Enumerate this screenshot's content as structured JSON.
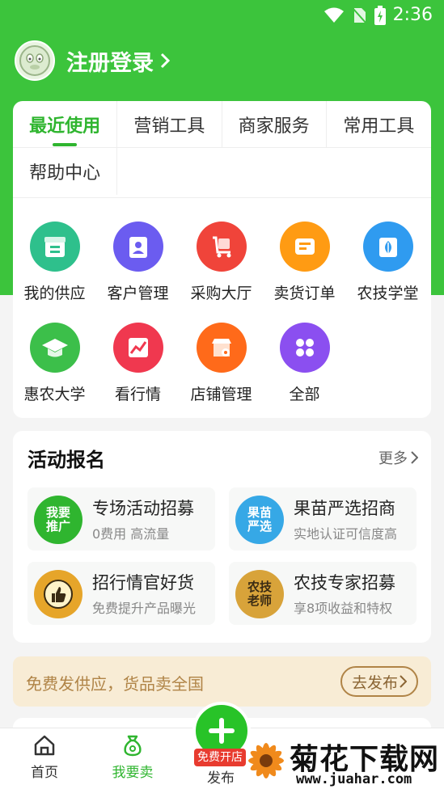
{
  "status_bar": {
    "time": "2:36"
  },
  "header": {
    "login_label": "注册登录"
  },
  "tabs": [
    {
      "label": "最近使用",
      "active": true
    },
    {
      "label": "营销工具",
      "active": false
    },
    {
      "label": "商家服务",
      "active": false
    },
    {
      "label": "常用工具",
      "active": false
    },
    {
      "label": "帮助中心",
      "active": false
    }
  ],
  "tools": [
    {
      "label": "我的供应",
      "icon": "supply-box-icon",
      "color": "#2ec08c"
    },
    {
      "label": "客户管理",
      "icon": "contact-card-icon",
      "color": "#6b5cf0"
    },
    {
      "label": "采购大厅",
      "icon": "cart-icon",
      "color": "#f0443a"
    },
    {
      "label": "卖货订单",
      "icon": "order-list-icon",
      "color": "#ff9b13"
    },
    {
      "label": "农技学堂",
      "icon": "leaf-book-icon",
      "color": "#2f9bf0"
    },
    {
      "label": "惠农大学",
      "icon": "graduation-cap-icon",
      "color": "#3cbf4a"
    },
    {
      "label": "看行情",
      "icon": "trend-chart-icon",
      "color": "#f0384f"
    },
    {
      "label": "店铺管理",
      "icon": "shop-gear-icon",
      "color": "#ff6a1a"
    },
    {
      "label": "全部",
      "icon": "all-grid-icon",
      "color": "#8b4ff0"
    }
  ],
  "events": {
    "title": "活动报名",
    "more_label": "更多",
    "items": [
      {
        "title": "专场活动招募",
        "subtitle": "0费用 高流量",
        "badge": "我要推广",
        "badge_color": "#2fb52f"
      },
      {
        "title": "果苗严选招商",
        "subtitle": "实地认证可信度高",
        "badge": "果苗严选",
        "badge_color": "#36a8e6"
      },
      {
        "title": "招行情官好货",
        "subtitle": "免费提升产品曝光",
        "badge": "thumbs-up-medal-icon",
        "badge_color": "#e6a52a"
      },
      {
        "title": "农技专家招募",
        "subtitle": "享8项收益和特权",
        "badge": "农技老师",
        "badge_color": "#d8a33a"
      }
    ]
  },
  "banner": {
    "text": "免费发供应，货品卖全国",
    "button": "去发布"
  },
  "bottom_nav": {
    "home": "首页",
    "sell": "我要卖",
    "publish": "发布",
    "publish_tag": "免费开店"
  },
  "watermark": {
    "main": "菊花下载网",
    "url": "www.juahar.com"
  }
}
